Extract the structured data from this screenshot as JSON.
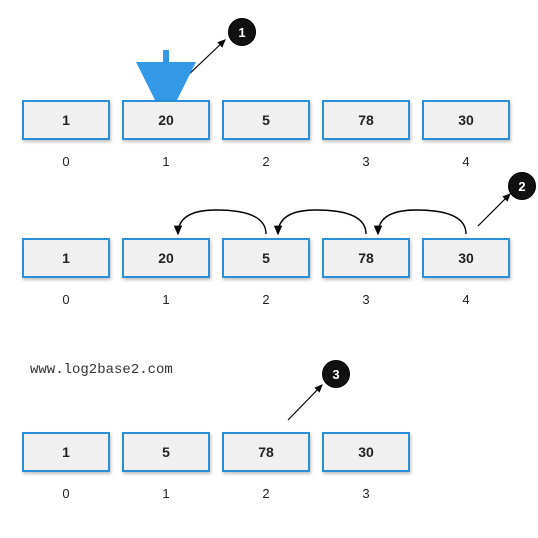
{
  "step1": {
    "badge": "1",
    "array": [
      "1",
      "20",
      "5",
      "78",
      "30"
    ],
    "indices": [
      "0",
      "1",
      "2",
      "3",
      "4"
    ]
  },
  "step2": {
    "badge": "2",
    "array": [
      "1",
      "20",
      "5",
      "78",
      "30"
    ],
    "indices": [
      "0",
      "1",
      "2",
      "3",
      "4"
    ]
  },
  "step3": {
    "badge": "3",
    "array": [
      "1",
      "5",
      "78",
      "30"
    ],
    "indices": [
      "0",
      "1",
      "2",
      "3"
    ]
  },
  "watermark": "www.log2base2.com",
  "colors": {
    "border": "#2b8fd8",
    "arrow": "#3399e6",
    "badge": "#111"
  }
}
